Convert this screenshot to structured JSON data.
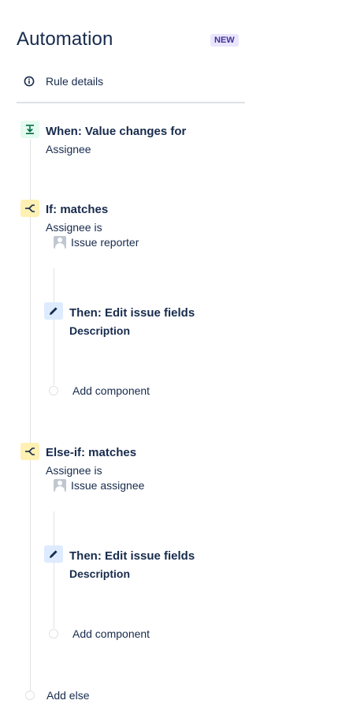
{
  "header": {
    "title": "Automation",
    "badge": "NEW"
  },
  "rule_details": {
    "label": "Rule details",
    "icon": "info-icon"
  },
  "trigger": {
    "icon": "trigger-icon",
    "title": "When: Value changes for",
    "field": "Assignee"
  },
  "condition_if": {
    "icon": "branch-icon",
    "title": "If: matches",
    "text": "Assignee is",
    "user": "Issue reporter",
    "action": {
      "icon": "pencil-icon",
      "title": "Then: Edit issue fields",
      "field": "Description"
    },
    "add_component": "Add component"
  },
  "condition_else_if": {
    "icon": "branch-icon",
    "title": "Else-if: matches",
    "text": "Assignee is",
    "user": "Issue assignee",
    "action": {
      "icon": "pencil-icon",
      "title": "Then: Edit issue fields",
      "field": "Description"
    },
    "add_component": "Add component"
  },
  "add_else": "Add else",
  "colors": {
    "trigger_bg": "#e3fcef",
    "condition_bg": "#fff0b3",
    "action_bg": "#deebff",
    "badge_bg": "#eae6ff",
    "badge_text": "#403294",
    "text": "#172b4d",
    "line": "#dfe1e6"
  }
}
